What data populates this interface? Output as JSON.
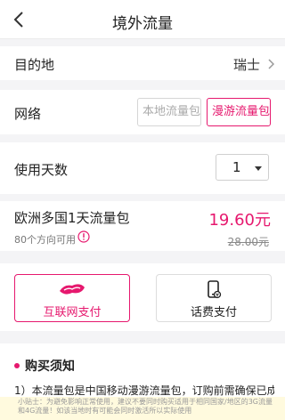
{
  "header": {
    "title": "境外流量"
  },
  "destination": {
    "label": "目的地",
    "value": "瑞士"
  },
  "network": {
    "label": "网络",
    "options": [
      "本地流量包",
      "漫游流量包"
    ],
    "selected": "漫游流量包"
  },
  "days": {
    "label": "使用天数",
    "value": "1"
  },
  "package": {
    "name": "欧洲多国1天流量包",
    "directions": "80个方向可用",
    "price": "19.60元",
    "original_price": "28.00元"
  },
  "payment": {
    "internet_pay": "互联网支付",
    "phone_pay": "话费支付"
  },
  "notes": {
    "heading": "购买须知",
    "item1": "1）本流量包是中国移动漫游流量包，订购前需确保已成功开"
  },
  "tip": {
    "text": "小贴士：为避免影响正常使用，建议不要同时购买适用于相同国家/地区的3G流量和4G流量！如该当地时有可能会同时激活所以实际使用"
  },
  "colors": {
    "accent": "#e6186e",
    "background": "#f4f4f6"
  }
}
